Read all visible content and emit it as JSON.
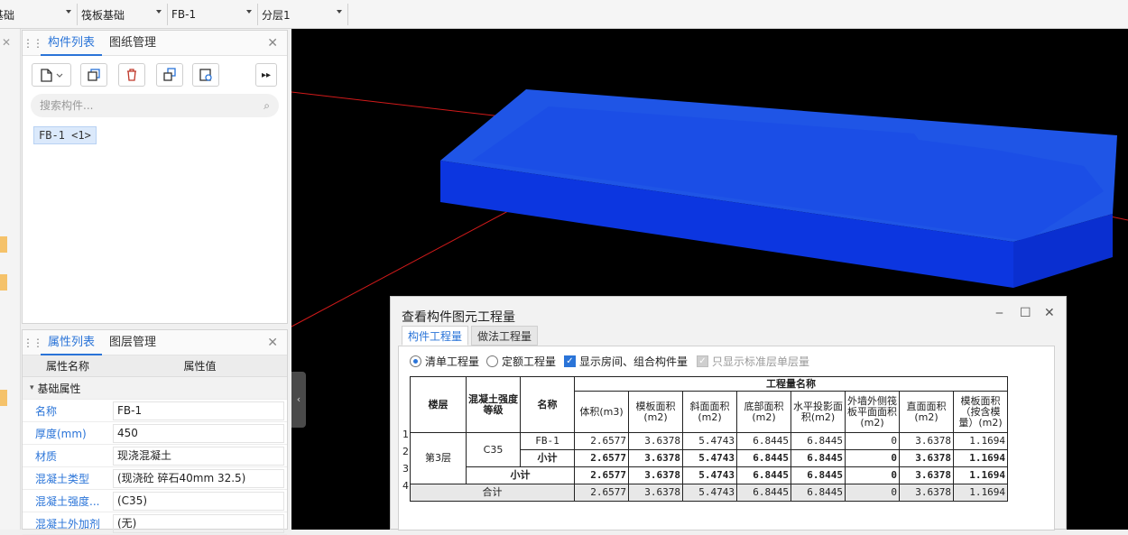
{
  "toolbar": {
    "combos": [
      {
        "value": "基础"
      },
      {
        "value": "筏板基础"
      },
      {
        "value": "FB-1"
      },
      {
        "value": "分层1"
      }
    ]
  },
  "component_panel": {
    "tabs": [
      "构件列表",
      "图纸管理"
    ],
    "search_placeholder": "搜索构件...",
    "selected_item": "FB-1 <1>"
  },
  "property_panel": {
    "tabs": [
      "属性列表",
      "图层管理"
    ],
    "col_name": "属性名称",
    "col_value": "属性值",
    "group": "基础属性",
    "rows": [
      {
        "name": "名称",
        "value": "FB-1"
      },
      {
        "name": "厚度(mm)",
        "value": "450"
      },
      {
        "name": "材质",
        "value": "现浇混凝土"
      },
      {
        "name": "混凝土类型",
        "value": "(现浇砼 碎石40mm 32.5)"
      },
      {
        "name": "混凝土强度...",
        "value": "(C35)"
      },
      {
        "name": "混凝土外加剂",
        "value": "(无)"
      }
    ]
  },
  "dialog": {
    "title": "查看构件图元工程量",
    "tabs": [
      "构件工程量",
      "做法工程量"
    ],
    "options": {
      "list_qty": "清单工程量",
      "quota_qty": "定额工程量",
      "show_room": "显示房间、组合构件量",
      "only_std": "只显示标准层单层量"
    },
    "table": {
      "group_header": "工程量名称",
      "headers": {
        "floor": "楼层",
        "grade": "混凝土强度等级",
        "name": "名称",
        "cols": [
          "体积(m3)",
          "模板面积(m2)",
          "斜面面积(m2)",
          "底部面积(m2)",
          "水平投影面积(m2)",
          "外墙外侧筏板平面面积(m2)",
          "直面面积(m2)",
          "模板面积（按含模量）(m2)"
        ]
      },
      "row_numbers": [
        "1",
        "2",
        "3",
        "4"
      ],
      "floor": "第3层",
      "grade": "C35",
      "rows": [
        {
          "name": "FB-1",
          "values": [
            "2.6577",
            "3.6378",
            "5.4743",
            "6.8445",
            "6.8445",
            "0",
            "3.6378",
            "1.1694"
          ]
        },
        {
          "name": "小计",
          "values": [
            "2.6577",
            "3.6378",
            "5.4743",
            "6.8445",
            "6.8445",
            "0",
            "3.6378",
            "1.1694"
          ]
        },
        {
          "name": "小计",
          "values": [
            "2.6577",
            "3.6378",
            "5.4743",
            "6.8445",
            "6.8445",
            "0",
            "3.6378",
            "1.1694"
          ]
        },
        {
          "name": "合计",
          "values": [
            "2.6577",
            "3.6378",
            "5.4743",
            "6.8445",
            "6.8445",
            "0",
            "3.6378",
            "1.1694"
          ]
        }
      ]
    }
  },
  "colors": {
    "accent": "#2a74d8",
    "slab_top": "#1f55e6",
    "slab_front": "#0c36e0",
    "viewport_bg": "#000000",
    "axis": "#d21a1a"
  }
}
